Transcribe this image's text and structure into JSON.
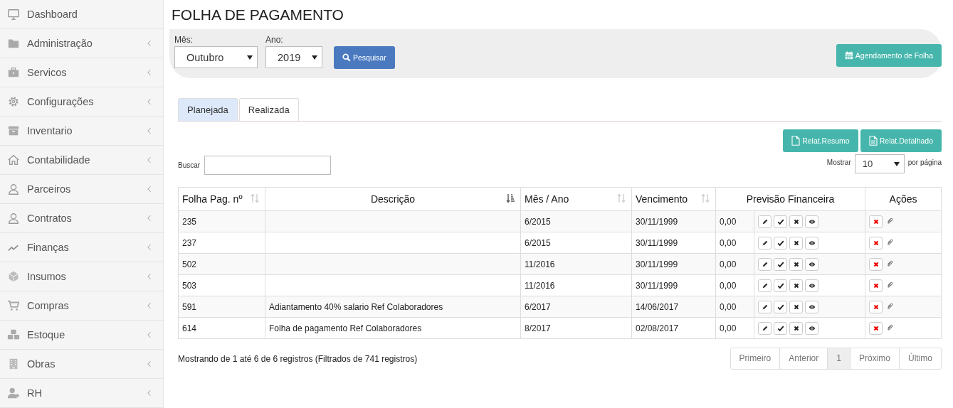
{
  "sidebar": {
    "items": [
      {
        "label": "Dashboard",
        "expandable": false
      },
      {
        "label": "Administração",
        "expandable": true
      },
      {
        "label": "Servicos",
        "expandable": true
      },
      {
        "label": "Configurações",
        "expandable": true
      },
      {
        "label": "Inventario",
        "expandable": true
      },
      {
        "label": "Contabilidade",
        "expandable": true
      },
      {
        "label": "Parceiros",
        "expandable": true
      },
      {
        "label": "Contratos",
        "expandable": true
      },
      {
        "label": "Finanças",
        "expandable": true
      },
      {
        "label": "Insumos",
        "expandable": true
      },
      {
        "label": "Compras",
        "expandable": true
      },
      {
        "label": "Estoque",
        "expandable": true
      },
      {
        "label": "Obras",
        "expandable": true
      },
      {
        "label": "RH",
        "expandable": true
      }
    ]
  },
  "page": {
    "title": "FOLHA DE PAGAMENTO"
  },
  "filters": {
    "month": {
      "label": "Mês:",
      "value": "Outubro"
    },
    "year": {
      "label": "Ano:",
      "value": "2019"
    },
    "search_button": "Pesquisar",
    "schedule_button": "Agendamento de Folha"
  },
  "tabs": [
    {
      "label": "Planejada",
      "selected": true
    },
    {
      "label": "Realizada",
      "selected": false
    }
  ],
  "report_buttons": [
    {
      "label": "Relat.Resumo"
    },
    {
      "label": "Relat.Detalhado"
    }
  ],
  "search": {
    "label": "Buscar"
  },
  "page_size": {
    "label": "Mostrar",
    "value": "10",
    "suffix": "por página"
  },
  "table": {
    "columns": [
      {
        "label": "Folha Pag. nº"
      },
      {
        "label": "Descrição"
      },
      {
        "label": "Mês / Ano"
      },
      {
        "label": "Vencimento"
      },
      {
        "label": "Previsão Financeira"
      },
      {
        "label": "Ações"
      }
    ],
    "rows": [
      {
        "number": "235",
        "description": "",
        "month_year": "6/2015",
        "due": "30/11/1999",
        "forecast": "0,00"
      },
      {
        "number": "237",
        "description": "",
        "month_year": "6/2015",
        "due": "30/11/1999",
        "forecast": "0,00"
      },
      {
        "number": "502",
        "description": "",
        "month_year": "11/2016",
        "due": "30/11/1999",
        "forecast": "0,00"
      },
      {
        "number": "503",
        "description": "",
        "month_year": "11/2016",
        "due": "30/11/1999",
        "forecast": "0,00"
      },
      {
        "number": "591",
        "description": "Adiantamento 40% salario Ref Colaboradores",
        "month_year": "6/2017",
        "due": "14/06/2017",
        "forecast": "0,00"
      },
      {
        "number": "614",
        "description": "Folha de pagamento Ref Colaboradores",
        "month_year": "8/2017",
        "due": "02/08/2017",
        "forecast": "0,00"
      }
    ]
  },
  "footer": {
    "info": "Mostrando de 1 até 6 de 6 registros (Filtrados de 741 registros)"
  },
  "pagination": [
    {
      "label": "Primeiro",
      "selected": false
    },
    {
      "label": "Anterior",
      "selected": false
    },
    {
      "label": "1",
      "selected": true
    },
    {
      "label": "Próximo",
      "selected": false
    },
    {
      "label": "Último",
      "selected": false
    }
  ]
}
